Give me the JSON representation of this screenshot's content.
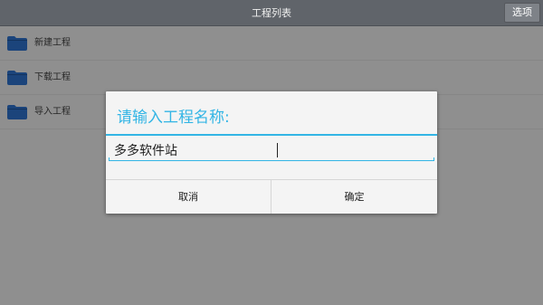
{
  "header": {
    "title": "工程列表",
    "options_label": "选项"
  },
  "projects": [
    {
      "label": "新建工程",
      "icon": "folder-icon"
    },
    {
      "label": "下载工程",
      "icon": "folder-icon"
    },
    {
      "label": "导入工程",
      "icon": "folder-icon"
    }
  ],
  "dialog": {
    "title": "请输入工程名称:",
    "input_value": "多多软件站",
    "cancel_label": "取消",
    "ok_label": "确定"
  },
  "colors": {
    "accent": "#33b5e5",
    "topbar": "#60646a",
    "folder": "#1f4e8c"
  }
}
